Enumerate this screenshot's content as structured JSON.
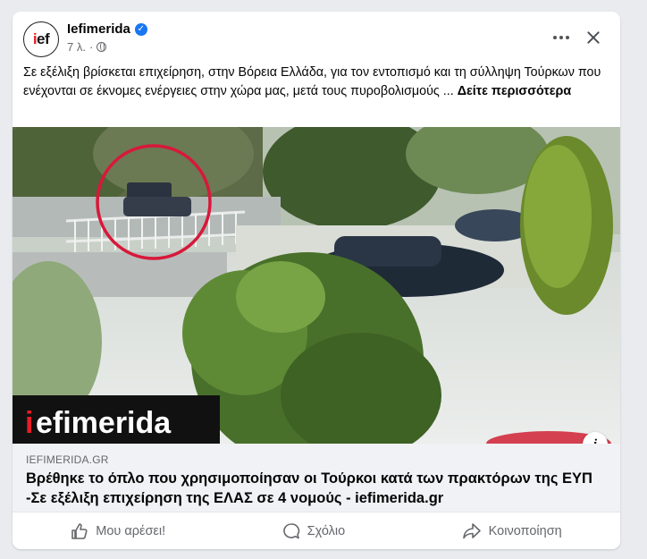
{
  "post": {
    "page_name": "Iefimerida",
    "timestamp": "7 λ.",
    "avatar_i": "i",
    "avatar_ef": "ef",
    "text": "Σε εξέλιξη βρίσκεται επιχείρηση, στην Βόρεια Ελλάδα, για τον εντοπισμό και τη σύλληψη Τούρκων που ενέχονται σε έκνομες ενέργειες στην χώρα μας, μετά τους πυροβολισμούς ...",
    "see_more": "Δείτε περισσότερα"
  },
  "image": {
    "watermark_i": "i",
    "watermark_rest": "efimerida",
    "highlight_color": "#d8183a"
  },
  "link": {
    "source": "IEFIMERIDA.GR",
    "title": "Βρέθηκε το όπλο που χρησιμοποίησαν οι Τούρκοι κατά των πρακτόρων της ΕΥΠ -Σε εξέλιξη επιχείρηση της ΕΛΑΣ σε 4 νομούς - iefimerida.gr",
    "info": "i"
  },
  "actions": {
    "like": "Μου αρέσει!",
    "comment": "Σχόλιο",
    "share": "Κοινοποίηση"
  },
  "colors": {
    "verified": "#1877f2",
    "secondary_text": "#65676b",
    "brand_red": "#e41e26"
  },
  "icons": {
    "verified": "verified-badge-icon",
    "audience": "globe-icon",
    "more": "more-options-icon",
    "close": "close-icon",
    "like": "thumbs-up-icon",
    "comment": "comment-icon",
    "share": "share-arrow-icon"
  }
}
